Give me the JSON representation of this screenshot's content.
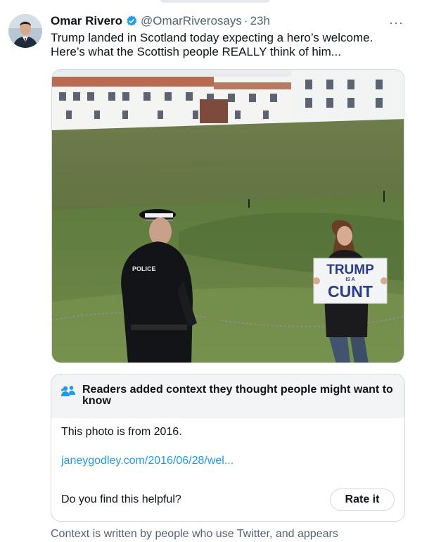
{
  "tweet": {
    "author_name": "Omar Rivero",
    "handle": "@OmarRiverosays",
    "separator": "·",
    "time": "23h",
    "more_label": "···",
    "text": "Trump landed in Scotland today expecting a hero’s welcome. Here’s what the Scottish people REALLY think of him...",
    "verified_icon": "verified-badge-icon",
    "colors": {
      "accent": "#1d9bf0",
      "muted": "#536471"
    }
  },
  "media": {
    "police_label": "POLICE",
    "sign_line1": "TRUMP",
    "sign_line2": "IS A",
    "sign_line3": "CUNT"
  },
  "note": {
    "icon": "people-icon",
    "title": "Readers added context they thought people might want to know",
    "body": "This photo is from 2016.",
    "link": "janeygodley.com/2016/06/28/wel...",
    "question": "Do you find this helpful?",
    "rate_button": "Rate it"
  },
  "footer": {
    "text": "Context is written by people who use Twitter, and appears"
  }
}
